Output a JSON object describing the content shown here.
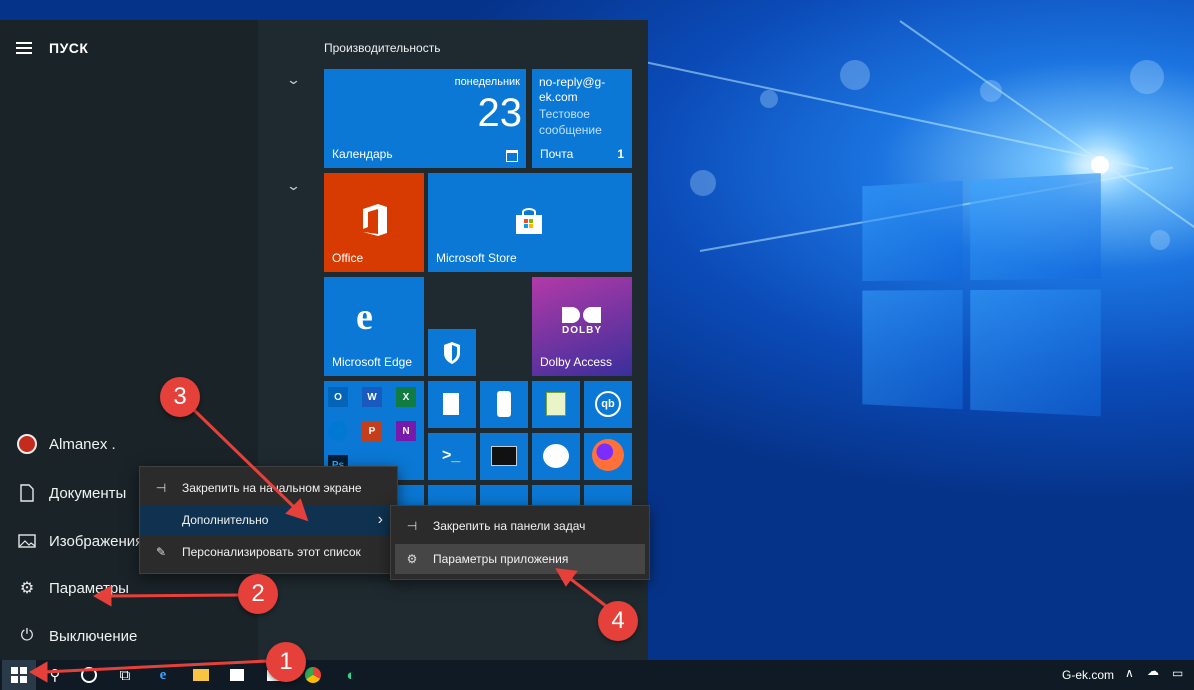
{
  "start_menu": {
    "title": "ПУСК",
    "group_title": "Производительность",
    "rail": {
      "user": "Almanex .",
      "documents": "Документы",
      "pictures": "Изображения",
      "settings": "Параметры",
      "power": "Выключение"
    }
  },
  "tiles": {
    "calendar": {
      "day_name": "понедельник",
      "day_number": "23",
      "label": "Календарь"
    },
    "mail": {
      "from": "no-reply@g-ek.com",
      "subject": "Тестовое",
      "preview": "сообщение",
      "label": "Почта",
      "count": "1"
    },
    "office": {
      "label": "Office"
    },
    "store": {
      "label": "Microsoft Store"
    },
    "edge": {
      "label": "Microsoft Edge"
    },
    "dolby": {
      "logo_text": "DOLBY",
      "label": "Dolby Access"
    },
    "mini_apps": [
      "O",
      "W",
      "X",
      "",
      "P",
      "N",
      "Ps"
    ]
  },
  "context_menu": {
    "pin_start": "Закрепить на начальном экране",
    "more": "Дополнительно",
    "personalize": "Персонализировать этот список"
  },
  "submenu": {
    "pin_taskbar": "Закрепить на панели задач",
    "app_settings": "Параметры приложения"
  },
  "taskbar": {
    "tray_site": "G-ek.com"
  },
  "callouts": [
    "1",
    "2",
    "3",
    "4"
  ],
  "colors": {
    "accent_blue": "#0a78d4",
    "office_red": "#d83b01",
    "callout_red": "#e5403a",
    "menu_highlight": "#0f3250"
  }
}
